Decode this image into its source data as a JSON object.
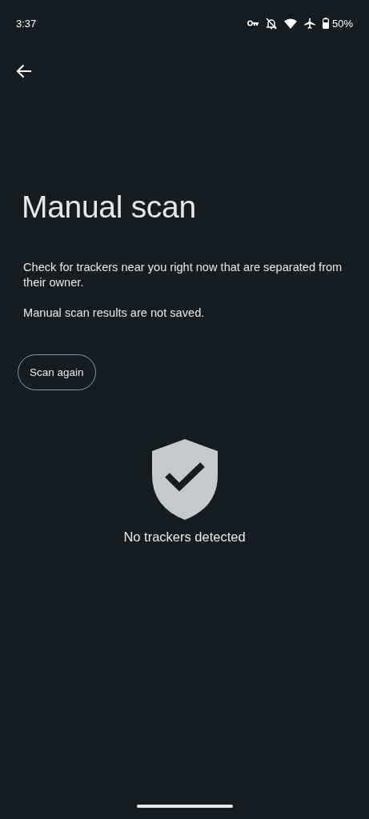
{
  "status_bar": {
    "time": "3:37",
    "battery": "50%"
  },
  "title": "Manual scan",
  "paragraphs": [
    "Check for trackers near you right now that are separated from their owner.",
    "Manual scan results are not saved."
  ],
  "button": "Scan again",
  "result": "No trackers detected"
}
